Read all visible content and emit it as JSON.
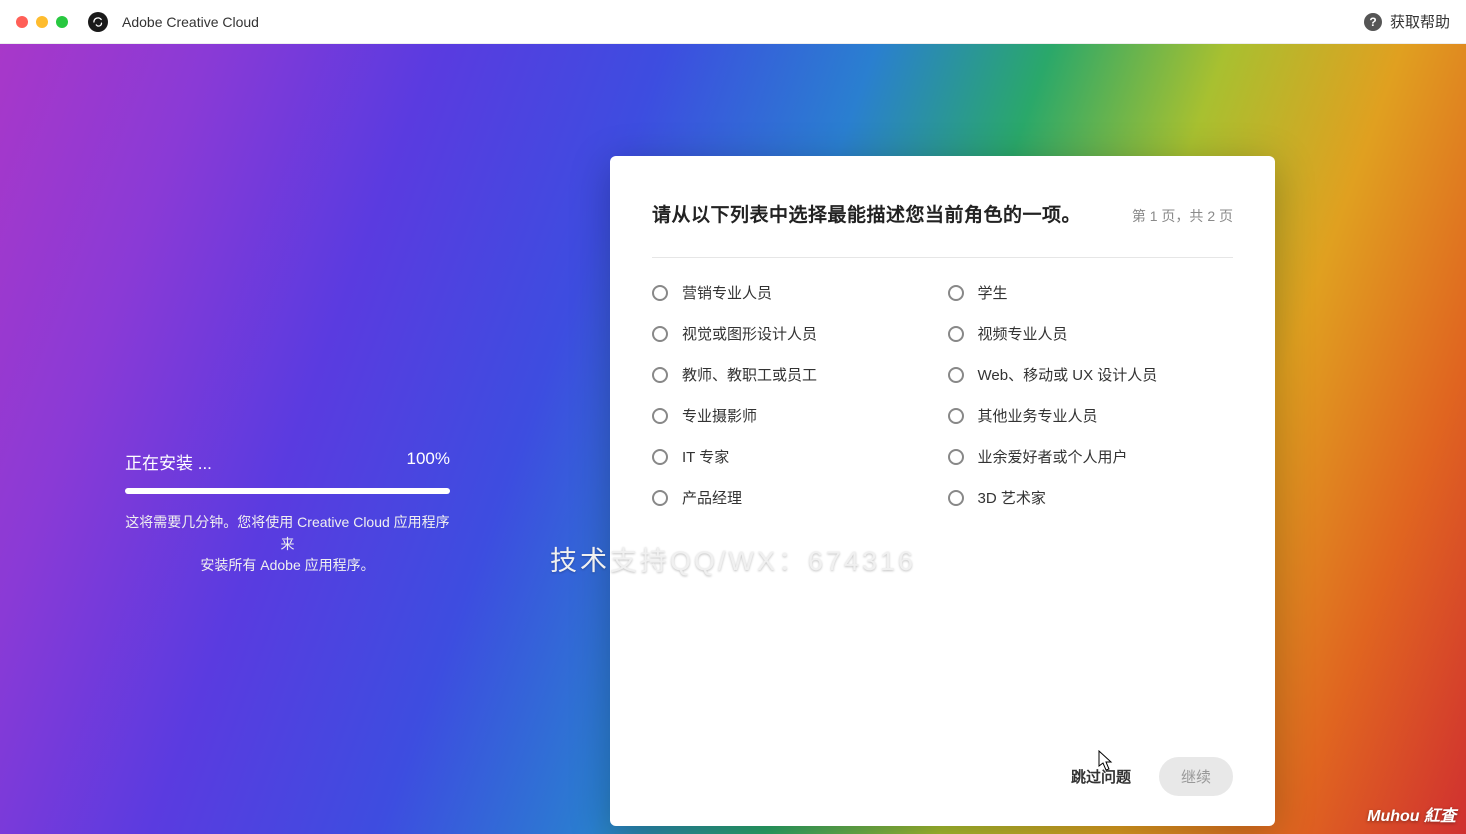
{
  "titlebar": {
    "app_name": "Adobe Creative Cloud",
    "help_label": "获取帮助"
  },
  "install": {
    "status": "正在安装 ...",
    "percent": "100%",
    "desc_line1": "这将需要几分钟。您将使用 Creative Cloud 应用程序来",
    "desc_line2": "安装所有 Adobe 应用程序。"
  },
  "card": {
    "title": "请从以下列表中选择最能描述您当前角色的一项。",
    "page_indicator": "第 1 页，共 2 页",
    "options_col1": [
      "营销专业人员",
      "视觉或图形设计人员",
      "教师、教职工或员工",
      "专业摄影师",
      "IT 专家",
      "产品经理"
    ],
    "options_col2": [
      "学生",
      "视频专业人员",
      "Web、移动或 UX 设计人员",
      "其他业务专业人员",
      "业余爱好者或个人用户",
      "3D 艺术家"
    ],
    "skip_label": "跳过问题",
    "continue_label": "继续"
  },
  "overlay": "技术支持QQ/WX：674316",
  "watermark": "Muhou 紅査"
}
